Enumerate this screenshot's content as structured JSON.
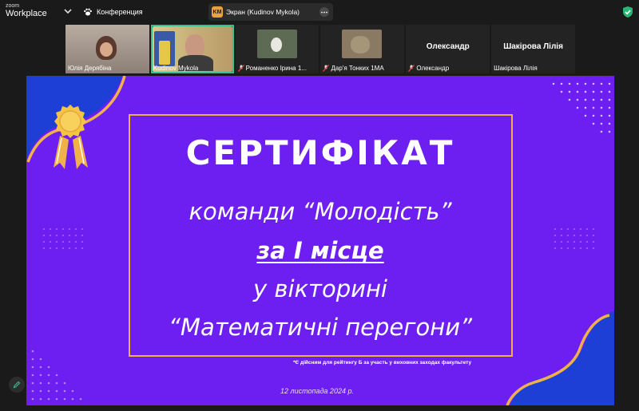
{
  "app": {
    "logo_top": "zoom",
    "logo_bottom": "Workplace",
    "meeting_label": "Конференция"
  },
  "share": {
    "initials": "KM",
    "label": "Экран (Kudinov Mykola)"
  },
  "participants": [
    {
      "name": "Юлія Дерябіна",
      "muted": false,
      "active": false
    },
    {
      "name": "Kudinov Mykola",
      "muted": false,
      "active": true
    },
    {
      "name": "Романенко Ірина 1...",
      "muted": true,
      "active": false
    },
    {
      "name": "Дар'я Тонких 1МА",
      "muted": true,
      "active": false
    },
    {
      "name": "Олександр",
      "big": "Олександр",
      "muted": true,
      "active": false
    },
    {
      "name": "Шакірова Лілія",
      "big": "Шакірова Лілія",
      "muted": false,
      "active": false
    }
  ],
  "slide": {
    "title": "СЕРТИФІКАТ",
    "team": "команди “Молодість”",
    "place": "за І місце",
    "quiz": "у вікторині",
    "quiz_name": "“Математичні перегони”",
    "note": "*Є дійсним для рейтингу Б за участь у виховних заходах факультету",
    "date": "12 листопада 2024 р."
  },
  "colors": {
    "slide_bg": "#6c1ff0",
    "accent_gold": "#f0b14a",
    "wave_blue": "#1e3fd6",
    "active_green": "#34c38f"
  },
  "icons": [
    "chevron-down-icon",
    "paw-icon",
    "more-icon",
    "shield-check-icon",
    "mic-muted-icon",
    "edit-icon"
  ]
}
